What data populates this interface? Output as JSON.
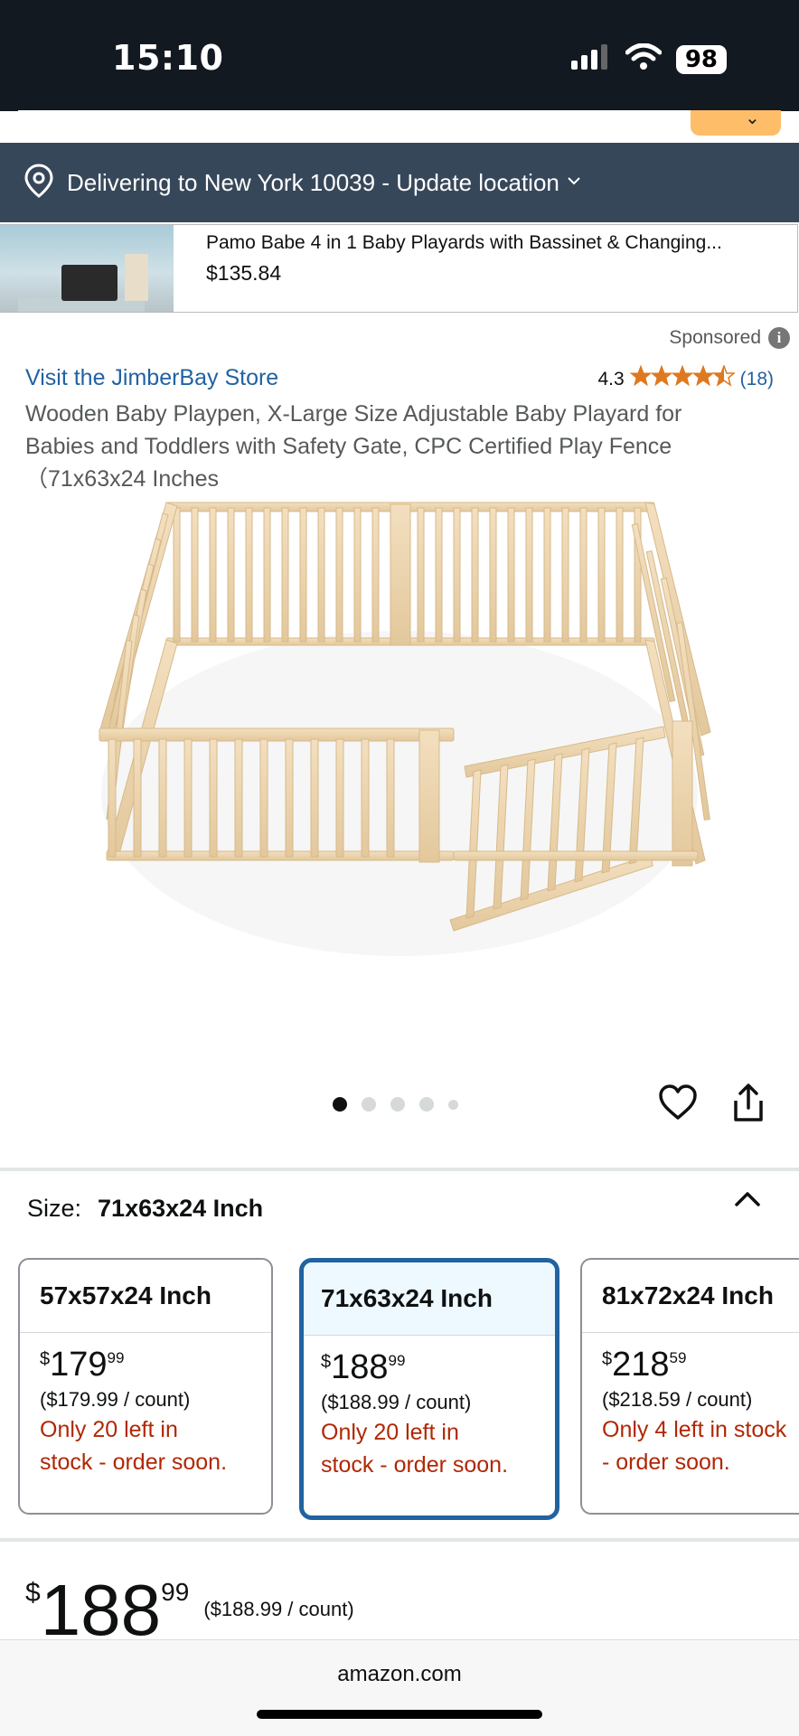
{
  "status_bar": {
    "time": "15:10",
    "battery": "98"
  },
  "delivery": {
    "text": "Delivering to New York 10039 - Update location"
  },
  "sponsored_card": {
    "title": "Pamo Babe 4 in 1 Baby Playards with Bassinet & Changing...",
    "price": "$135.84"
  },
  "sponsored_label": "Sponsored",
  "product": {
    "store_link": "Visit the JimberBay Store",
    "rating_value": "4.3",
    "rating_count": "(18)",
    "stars": "★★★★⯪",
    "title_line1": "Wooden Baby Playpen, X-Large Size Adjustable Baby Playard for",
    "title_line2": "Babies and Toddlers with Safety Gate, CPC Certified Play Fence",
    "title_line3": "（71x63x24 Inches"
  },
  "carousel": {
    "total_dots": 5,
    "active_index": 0
  },
  "size": {
    "label": "Size:",
    "selected": "71x63x24 Inch",
    "options": [
      {
        "name": "57x57x24 Inch",
        "currency": "$",
        "whole": "179",
        "fraction": "99",
        "unit_price": "($179.99 / count)",
        "stock_line1": "Only 20 left in",
        "stock_line2": "stock - order soon."
      },
      {
        "name": "71x63x24 Inch",
        "currency": "$",
        "whole": "188",
        "fraction": "99",
        "unit_price": "($188.99 / count)",
        "stock_line1": "Only 20 left in",
        "stock_line2": "stock - order soon."
      },
      {
        "name": "81x72x24 Inch",
        "currency": "$",
        "whole": "218",
        "fraction": "59",
        "unit_price": "($218.59 / count)",
        "stock_line1": "Only 4 left in stock",
        "stock_line2": "- order soon."
      }
    ]
  },
  "price": {
    "currency": "$",
    "whole": "188",
    "fraction": "99",
    "unit_price": "($188.99 / count)"
  },
  "browser": {
    "domain": "amazon.com"
  },
  "colors": {
    "header_bg": "#131921",
    "delivery_bg": "#37475a",
    "link": "#2162a1",
    "stars": "#de7921",
    "stock_red": "#b12704",
    "search_button": "#febd69"
  }
}
